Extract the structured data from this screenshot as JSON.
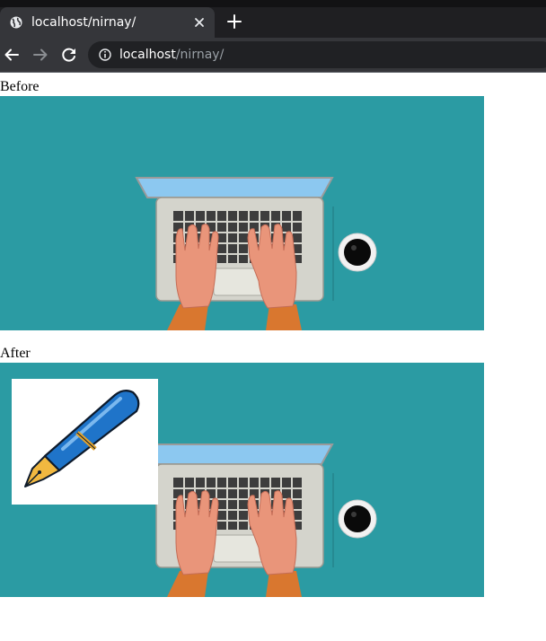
{
  "browser": {
    "tab_title": "localhost/nirnay/",
    "url_host": "localhost",
    "url_path": "/nirnay/"
  },
  "page": {
    "before_label": "Before",
    "after_label": "After"
  },
  "icons": {
    "favicon": "globe-icon",
    "tab_close": "close-icon",
    "new_tab": "plus-icon",
    "back": "back-arrow-icon",
    "forward": "forward-arrow-icon",
    "reload": "reload-icon",
    "site_info": "info-icon"
  },
  "colors": {
    "image_background": "#2b9ba3",
    "chrome_dark": "#35363a"
  }
}
